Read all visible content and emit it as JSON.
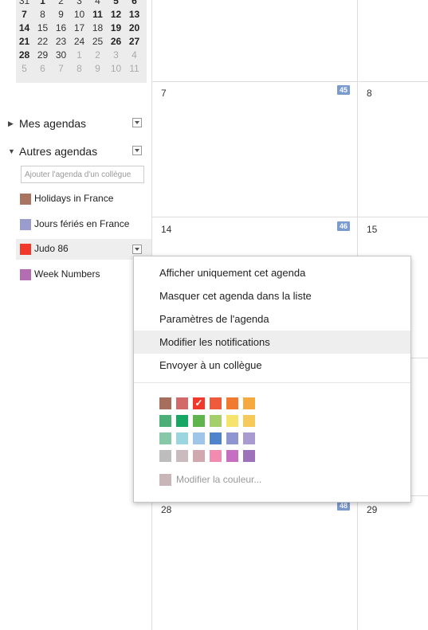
{
  "mini_calendar": {
    "rows": [
      [
        {
          "t": "31",
          "s": "n"
        },
        {
          "t": "1",
          "s": "b"
        },
        {
          "t": "2",
          "s": "n"
        },
        {
          "t": "3",
          "s": "n"
        },
        {
          "t": "4",
          "s": "n"
        },
        {
          "t": "5",
          "s": "b"
        },
        {
          "t": "6",
          "s": "b"
        }
      ],
      [
        {
          "t": "7",
          "s": "b"
        },
        {
          "t": "8",
          "s": "n"
        },
        {
          "t": "9",
          "s": "n"
        },
        {
          "t": "10",
          "s": "n"
        },
        {
          "t": "11",
          "s": "b"
        },
        {
          "t": "12",
          "s": "b"
        },
        {
          "t": "13",
          "s": "b"
        }
      ],
      [
        {
          "t": "14",
          "s": "b"
        },
        {
          "t": "15",
          "s": "n"
        },
        {
          "t": "16",
          "s": "n"
        },
        {
          "t": "17",
          "s": "n"
        },
        {
          "t": "18",
          "s": "n"
        },
        {
          "t": "19",
          "s": "b"
        },
        {
          "t": "20",
          "s": "b"
        }
      ],
      [
        {
          "t": "21",
          "s": "b"
        },
        {
          "t": "22",
          "s": "n"
        },
        {
          "t": "23",
          "s": "n"
        },
        {
          "t": "24",
          "s": "n"
        },
        {
          "t": "25",
          "s": "n"
        },
        {
          "t": "26",
          "s": "b"
        },
        {
          "t": "27",
          "s": "b"
        }
      ],
      [
        {
          "t": "28",
          "s": "b"
        },
        {
          "t": "29",
          "s": "n"
        },
        {
          "t": "30",
          "s": "n"
        },
        {
          "t": "1",
          "s": "g"
        },
        {
          "t": "2",
          "s": "g"
        },
        {
          "t": "3",
          "s": "g"
        },
        {
          "t": "4",
          "s": "g"
        }
      ],
      [
        {
          "t": "5",
          "s": "g"
        },
        {
          "t": "6",
          "s": "g"
        },
        {
          "t": "7",
          "s": "g"
        },
        {
          "t": "8",
          "s": "g"
        },
        {
          "t": "9",
          "s": "g"
        },
        {
          "t": "10",
          "s": "g"
        },
        {
          "t": "11",
          "s": "g"
        }
      ]
    ]
  },
  "sidebar": {
    "my_calendars_label": "Mes agendas",
    "other_calendars_label": "Autres agendas",
    "add_colleague_placeholder": "Ajouter l'agenda d'un collègue",
    "calendars": [
      {
        "label": "Holidays in France",
        "color": "#a67461"
      },
      {
        "label": "Jours fériés en France",
        "color": "#9a9cd0"
      },
      {
        "label": "Judo 86",
        "color": "#f0392b"
      },
      {
        "label": "Week Numbers",
        "color": "#b36db3"
      }
    ]
  },
  "grid": {
    "days": [
      {
        "num": "7",
        "week": "45"
      },
      {
        "num": "8",
        "week": ""
      },
      {
        "num": "14",
        "week": "46"
      },
      {
        "num": "15",
        "week": ""
      },
      {
        "num": "28",
        "week": "48"
      },
      {
        "num": "29",
        "week": ""
      }
    ]
  },
  "context_menu": {
    "items": [
      "Afficher uniquement cet agenda",
      "Masquer cet agenda dans la liste",
      "Paramètres de l'agenda",
      "Modifier les notifications",
      "Envoyer à un collègue"
    ],
    "colors": [
      [
        "#a66e5c",
        "#d36a6a",
        "#f0392b",
        "#f05a3c",
        "#f07a30",
        "#f5a93f"
      ],
      [
        "#4caf77",
        "#16a765",
        "#5fb54b",
        "#a5cf6a",
        "#f5e36b",
        "#f5c95a"
      ],
      [
        "#86c8a7",
        "#9ad5e0",
        "#9fc5e8",
        "#4f84cc",
        "#8f96cf",
        "#a99bd0"
      ],
      [
        "#bdbdbd",
        "#cabcbe",
        "#d2a8b0",
        "#f28bb0",
        "#c56fc3",
        "#9e72ba"
      ]
    ],
    "selected_color": "#f0392b",
    "modify_color_label": "Modifier la couleur..."
  }
}
